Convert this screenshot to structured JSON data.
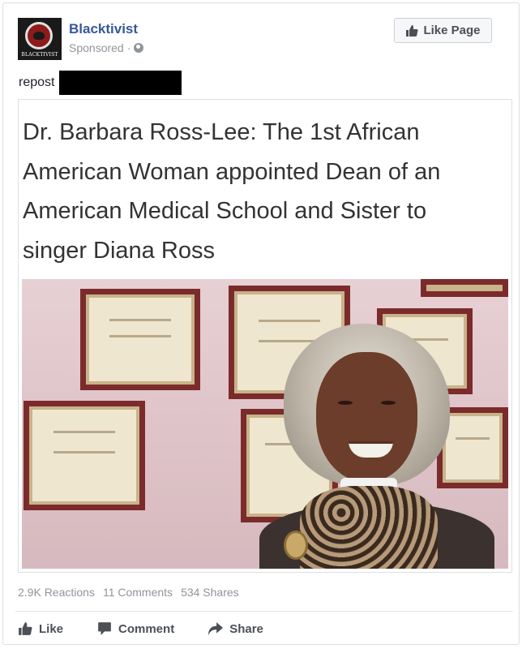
{
  "header": {
    "page_name": "Blacktivist",
    "sponsored_label": "Sponsored",
    "separator": "·",
    "avatar_wordmark": "BLACKTIVIST",
    "like_page_label": "Like Page"
  },
  "post": {
    "text": "repost"
  },
  "shared": {
    "headline": "Dr. Barbara Ross-Lee: The 1st African American Woman appointed Dean of an American Medical School and Sister to singer Diana Ross"
  },
  "stats": {
    "reactions": "2.9K Reactions",
    "comments": "11 Comments",
    "shares": "534 Shares"
  },
  "actions": {
    "like": "Like",
    "comment": "Comment",
    "share": "Share"
  },
  "colors": {
    "link_blue": "#365899",
    "meta_gray": "#90949c",
    "action_gray": "#4b4f56"
  },
  "icons": [
    "globe-icon",
    "thumbs-up-icon",
    "comment-icon",
    "share-arrow-icon"
  ]
}
